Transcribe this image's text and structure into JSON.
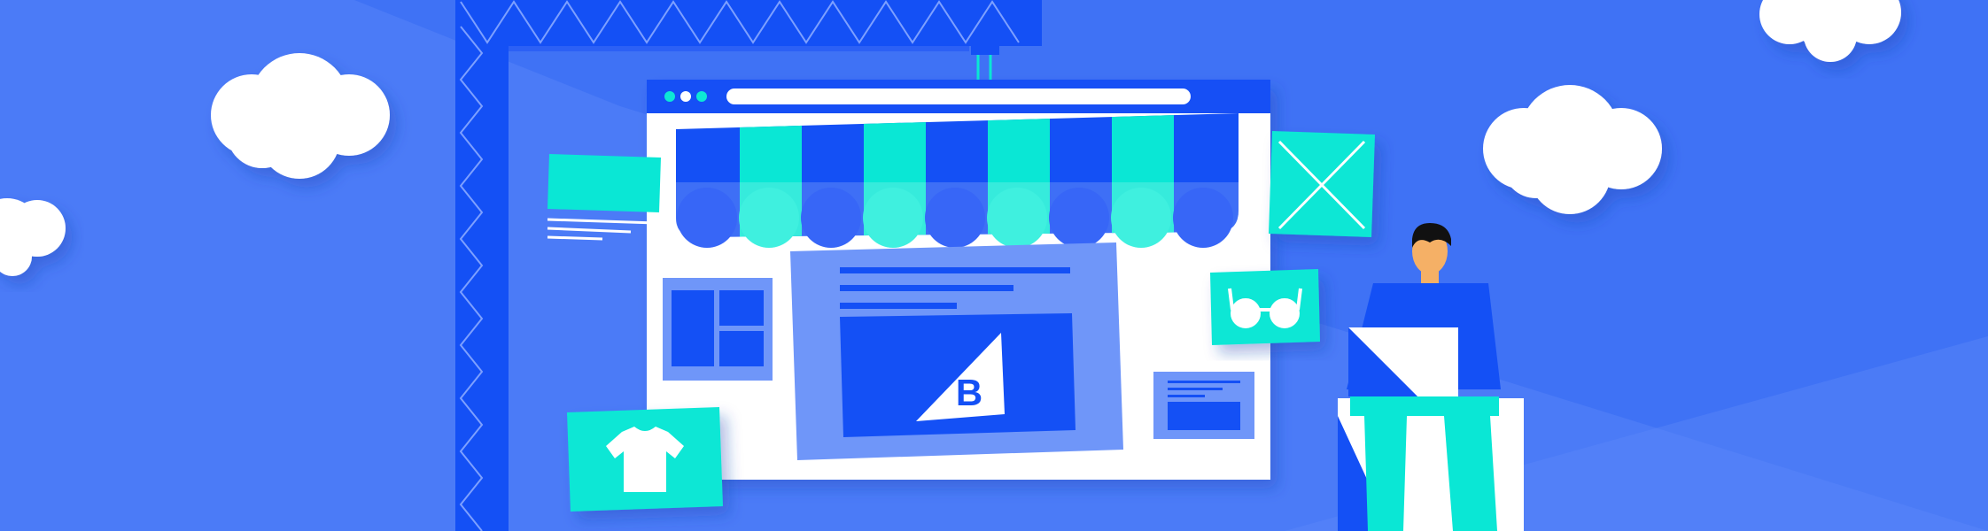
{
  "illustration": {
    "logo_letter": "B",
    "colors": {
      "background": "#3f72f5",
      "background_light": "#5583f7",
      "primary_blue": "#1450f5",
      "panel_blue": "#6f96f9",
      "teal": "#0ae7d5",
      "white": "#ffffff",
      "skin": "#f5b066",
      "hair": "#111111"
    },
    "icons": [
      "crane",
      "storefront-awning",
      "browser-window",
      "tshirt-icon",
      "glasses-icon",
      "image-placeholder-icon",
      "cloud",
      "person"
    ]
  }
}
